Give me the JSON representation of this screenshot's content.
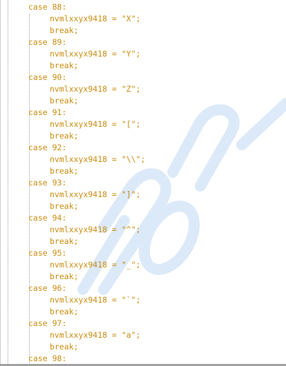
{
  "variable": "nvmlxxyx9418",
  "cases": [
    {
      "label": "case 88:",
      "assign": "nvmlxxyx9418 = \"X\";",
      "brk": "break;"
    },
    {
      "label": "case 89:",
      "assign": "nvmlxxyx9418 = \"Y\";",
      "brk": "break;"
    },
    {
      "label": "case 90:",
      "assign": "nvmlxxyx9418 = \"Z\";",
      "brk": "break;"
    },
    {
      "label": "case 91:",
      "assign": "nvmlxxyx9418 = \"[\";",
      "brk": "break;"
    },
    {
      "label": "case 92:",
      "assign": "nvmlxxyx9418 = \"\\\\\";",
      "brk": "break;"
    },
    {
      "label": "case 93:",
      "assign": "nvmlxxyx9418 = \"]\";",
      "brk": "break;"
    },
    {
      "label": "case 94:",
      "assign": "nvmlxxyx9418 = \"^\";",
      "brk": "break;"
    },
    {
      "label": "case 95:",
      "assign": "nvmlxxyx9418 = \"_\";",
      "brk": "break;"
    },
    {
      "label": "case 96:",
      "assign": "nvmlxxyx9418 = \"`\";",
      "brk": "break;"
    },
    {
      "label": "case 97:",
      "assign": "nvmlxxyx9418 = \"a\";",
      "brk": "break;"
    },
    {
      "label": "case 98:"
    }
  ],
  "colors": {
    "code_text": "#c88a0a",
    "watermark": "#cfe1f7",
    "background": "#ffffff"
  }
}
